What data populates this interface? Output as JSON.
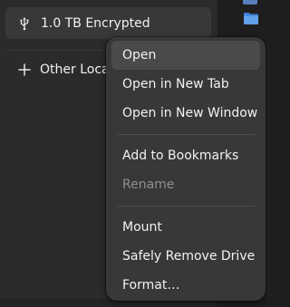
{
  "sidebar": {
    "drive": {
      "label": "1.0 TB Encrypted",
      "icon": "usb-icon"
    },
    "other_locations": {
      "label": "Other Locations",
      "icon": "plus-icon"
    }
  },
  "context_menu": {
    "groups": [
      [
        {
          "label": "Open",
          "highlighted": true
        },
        {
          "label": "Open in New Tab"
        },
        {
          "label": "Open in New Window"
        }
      ],
      [
        {
          "label": "Add to Bookmarks"
        },
        {
          "label": "Rename",
          "disabled": true
        }
      ],
      [
        {
          "label": "Mount"
        },
        {
          "label": "Safely Remove Drive"
        },
        {
          "label": "Format…"
        }
      ]
    ]
  },
  "colors": {
    "menu_bg": "#383838",
    "sidebar_bg": "#2b2b2b",
    "selected_row_bg": "#383838",
    "folder_blue": "#62a0ea"
  }
}
